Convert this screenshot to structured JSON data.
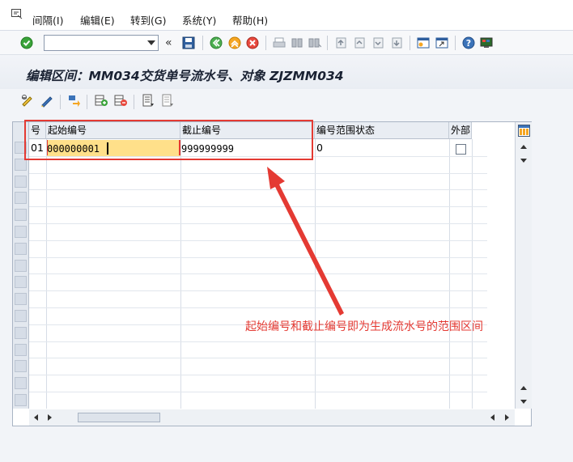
{
  "menu": {
    "items": [
      {
        "label": "间隔(I)"
      },
      {
        "label": "编辑(E)"
      },
      {
        "label": "转到(G)"
      },
      {
        "label": "系统(Y)"
      },
      {
        "label": "帮助(H)"
      }
    ]
  },
  "toolbar": {
    "command_value": "",
    "icons": [
      "enter-icon",
      "save-icon",
      "back-icon",
      "exit-icon",
      "cancel-icon",
      "print-icon",
      "find-icon",
      "find-next-icon",
      "first-page-icon",
      "previous-page-icon",
      "next-page-icon",
      "last-page-icon",
      "create-session-icon",
      "shortcut-icon",
      "help-icon",
      "layout-menu-icon"
    ]
  },
  "title": "编辑区间：MM034交货单号流水号、对象 ZJZMM034",
  "table": {
    "columns": [
      "号",
      "起始编号",
      "截止编号",
      "编号范围状态",
      "外部"
    ],
    "rows": [
      {
        "no": "01",
        "start": "000000001",
        "end": "999999999",
        "status": "0",
        "external": false
      }
    ]
  },
  "annotation": {
    "text": "起始编号和截止编号即为生成流水号的范围区间",
    "color": "#e43a33"
  },
  "colors": {
    "highlight": "#ffe08a",
    "annotation": "#e43a33"
  }
}
